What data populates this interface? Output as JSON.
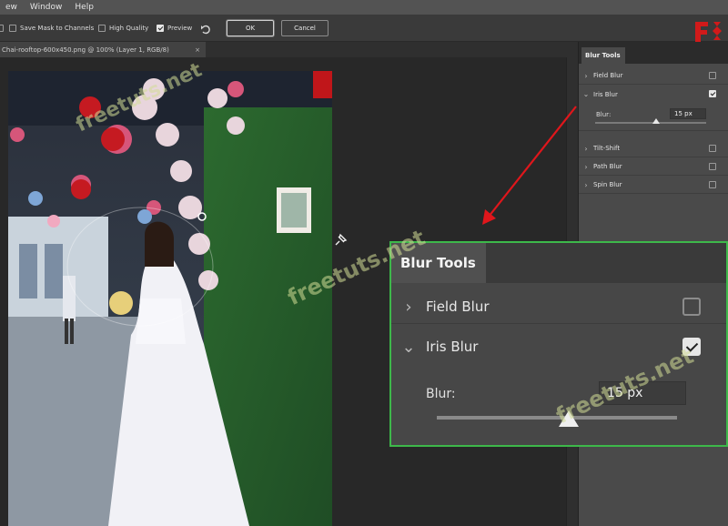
{
  "menubar": {
    "items": [
      "ew",
      "Window",
      "Help"
    ]
  },
  "options": {
    "save_mask": "Save Mask to Channels",
    "high_quality": "High Quality",
    "preview": "Preview",
    "ok": "OK",
    "cancel": "Cancel"
  },
  "document": {
    "tab_title": "Chai-rooftop-600x450.png @ 100% (Layer 1, RGB/8)",
    "close": "×"
  },
  "panel": {
    "title": "Blur Tools",
    "items": [
      {
        "label": "Field Blur",
        "checked": false,
        "expanded": false
      },
      {
        "label": "Iris Blur",
        "checked": true,
        "expanded": true
      },
      {
        "label": "Tilt-Shift",
        "checked": false,
        "expanded": false
      },
      {
        "label": "Path Blur",
        "checked": false,
        "expanded": false
      },
      {
        "label": "Spin Blur",
        "checked": false,
        "expanded": false
      }
    ],
    "blur_label": "Blur:",
    "blur_value": "15 px",
    "blur_slider_fraction": 0.55
  },
  "zoom_callout": {
    "title": "Blur Tools",
    "field_blur": "Field Blur",
    "iris_blur": "Iris Blur",
    "blur_label": "Blur:",
    "blur_value": "15 px"
  },
  "watermarks": [
    "freetuts.net",
    "freetuts.net",
    "freetuts.net"
  ],
  "colors": {
    "accent_green": "#3db84a",
    "arrow_red": "#e0161b",
    "logo_red": "#d11a1a"
  },
  "icons": [
    "undo-icon",
    "chevron-right-icon",
    "chevron-down-icon",
    "checkbox-icon",
    "pin-cursor-icon",
    "freetuts-logo"
  ]
}
